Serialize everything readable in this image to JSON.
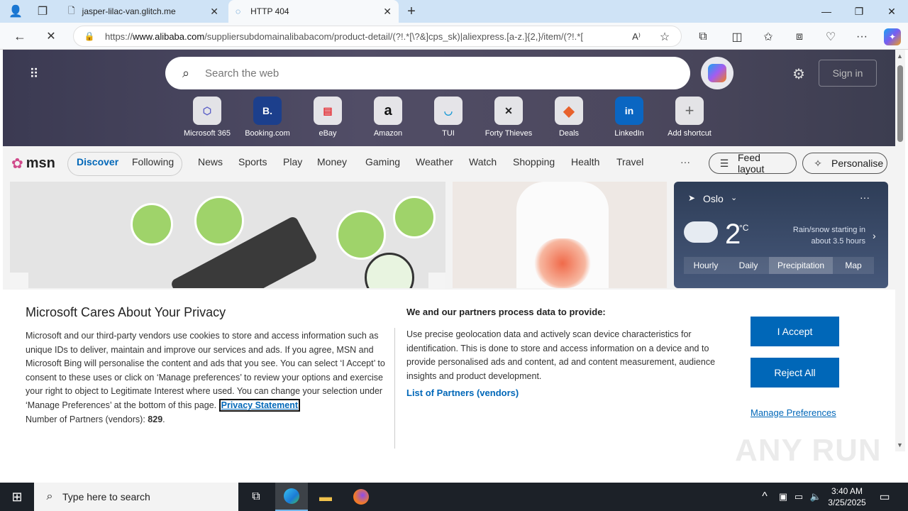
{
  "browser": {
    "tabs": [
      {
        "title": "jasper-lilac-van.glitch.me"
      },
      {
        "title": "HTTP 404"
      }
    ],
    "url_prefix": "https://",
    "url_host": "www.alibaba.com",
    "url_rest": "/suppliersubdomainalibabacom/product-detail/(?!.*[\\?&]cps_sk)|aliexpress.[a-z.]{2,}/item/(?!.*["
  },
  "newtab": {
    "search_placeholder": "Search the web",
    "sign_in": "Sign in",
    "shortcuts": [
      {
        "label": "Microsoft 365",
        "glyph": "⬡",
        "color": "#5b5fc7"
      },
      {
        "label": "Booking.com",
        "glyph": "B.",
        "color": "#003580"
      },
      {
        "label": "eBay",
        "glyph": "▤",
        "color": "#e53238"
      },
      {
        "label": "Amazon",
        "glyph": "a",
        "color": "#111111"
      },
      {
        "label": "TUI",
        "glyph": "◡",
        "color": "#1a9ad6"
      },
      {
        "label": "Forty Thieves",
        "glyph": "✕",
        "color": "#222222"
      },
      {
        "label": "Deals",
        "glyph": "◆",
        "color": "#e8612c"
      },
      {
        "label": "LinkedIn",
        "glyph": "in",
        "color": "#0a66c2"
      },
      {
        "label": "Add shortcut",
        "glyph": "+",
        "color": "#555555"
      }
    ]
  },
  "msn": {
    "logo": "msn",
    "discover": "Discover",
    "following": "Following",
    "nav": [
      "News",
      "Sports",
      "Play",
      "Money",
      "Gaming",
      "Weather",
      "Watch",
      "Shopping",
      "Health",
      "Travel"
    ],
    "more": "···",
    "feed_layout": "Feed layout",
    "personalise": "Personalise"
  },
  "weather": {
    "city": "Oslo",
    "temp": "2",
    "unit": "°C",
    "note": "Rain/snow starting in about 3.5 hours",
    "tabs": [
      "Hourly",
      "Daily",
      "Precipitation",
      "Map"
    ]
  },
  "consent": {
    "title": "Microsoft Cares About Your Privacy",
    "body": "Microsoft and our third-party vendors use cookies to store and access information such as unique IDs to deliver, maintain and improve our services and ads. If you agree, MSN and Microsoft Bing will personalise the content and ads that you see. You can select ‘I Accept’ to consent to these uses or click on ‘Manage preferences’ to review your options and exercise your right to object to Legitimate Interest where used.  You can change your selection under ‘Manage Preferences’ at the bottom of this page.",
    "privacy_link": "Privacy Statement",
    "partners_label": "Number of Partners (vendors):",
    "partners_count": "829",
    "right_title": "We and our partners process data to provide:",
    "right_body": "Use precise geolocation data and actively scan device characteristics for identification. This is done to store and access information on a device and to provide personalised ads and content, ad and content measurement, audience insights and product development.",
    "vendors_link": "List of Partners (vendors)",
    "accept": "I Accept",
    "reject": "Reject All",
    "manage": "Manage Preferences"
  },
  "taskbar": {
    "search_placeholder": "Type here to search",
    "time": "3:40 AM",
    "date": "3/25/2025"
  },
  "watermark": "ANY RUN"
}
